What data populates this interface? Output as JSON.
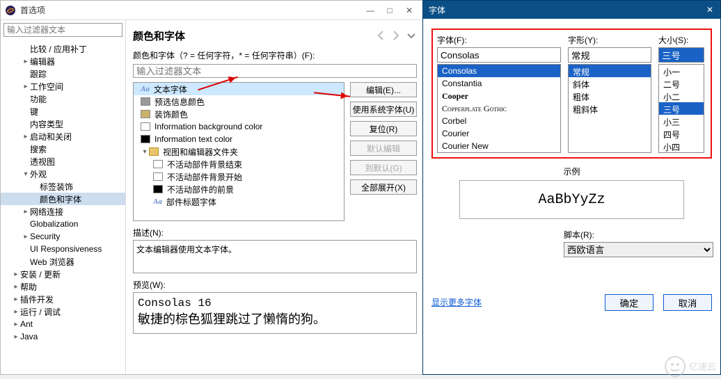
{
  "prefs": {
    "title": "首选项",
    "filter_placeholder": "输入过滤器文本",
    "tree": [
      {
        "label": "比较 / 应用补丁",
        "indent": 2,
        "tw": ""
      },
      {
        "label": "编辑器",
        "indent": 2,
        "tw": "▸"
      },
      {
        "label": "跟踪",
        "indent": 2,
        "tw": ""
      },
      {
        "label": "工作空间",
        "indent": 2,
        "tw": "▸"
      },
      {
        "label": "功能",
        "indent": 2,
        "tw": ""
      },
      {
        "label": "键",
        "indent": 2,
        "tw": ""
      },
      {
        "label": "内容类型",
        "indent": 2,
        "tw": ""
      },
      {
        "label": "启动和关闭",
        "indent": 2,
        "tw": "▸"
      },
      {
        "label": "搜索",
        "indent": 2,
        "tw": ""
      },
      {
        "label": "透视图",
        "indent": 2,
        "tw": ""
      },
      {
        "label": "外观",
        "indent": 2,
        "tw": "▾",
        "open": true
      },
      {
        "label": "标签装饰",
        "indent": 3,
        "tw": ""
      },
      {
        "label": "颜色和字体",
        "indent": 3,
        "tw": "",
        "sel": true
      },
      {
        "label": "网络连接",
        "indent": 2,
        "tw": "▸"
      },
      {
        "label": "Globalization",
        "indent": 2,
        "tw": ""
      },
      {
        "label": "Security",
        "indent": 2,
        "tw": "▸"
      },
      {
        "label": "UI Responsiveness",
        "indent": 2,
        "tw": ""
      },
      {
        "label": "Web 浏览器",
        "indent": 2,
        "tw": ""
      },
      {
        "label": "安装 / 更新",
        "indent": 1,
        "tw": "▸"
      },
      {
        "label": "帮助",
        "indent": 1,
        "tw": "▸"
      },
      {
        "label": "插件开发",
        "indent": 1,
        "tw": "▸"
      },
      {
        "label": "运行 / 调试",
        "indent": 1,
        "tw": "▸"
      },
      {
        "label": "Ant",
        "indent": 1,
        "tw": "▸"
      },
      {
        "label": "Java",
        "indent": 1,
        "tw": "▸"
      }
    ]
  },
  "right": {
    "heading": "颜色和字体",
    "hint": "颜色和字体（? = 任何字符，* = 任何字符串）(F):",
    "filter_placeholder": "输入过滤器文本",
    "items": [
      {
        "type": "aa",
        "label": "文本字体",
        "sel": true
      },
      {
        "type": "sw",
        "color": "#9a9a9a",
        "label": "预选信息颜色"
      },
      {
        "type": "sw",
        "color": "#c9b26a",
        "label": "装饰颜色"
      },
      {
        "type": "sw",
        "color": "#ffffff",
        "label": "Information background color"
      },
      {
        "type": "sw",
        "color": "#000000",
        "label": "Information text color"
      },
      {
        "type": "folder",
        "label": "视图和编辑器文件夹",
        "tw": "▾"
      },
      {
        "type": "sw",
        "color": "#ffffff",
        "label": "不活动部件背景结束",
        "indent": true
      },
      {
        "type": "sw",
        "color": "#ffffff",
        "label": "不活动部件背景开始",
        "indent": true
      },
      {
        "type": "sw",
        "color": "#000000",
        "label": "不活动部件的前景",
        "indent": true
      },
      {
        "type": "aa",
        "label": "部件标题字体",
        "indent": true
      }
    ],
    "buttons": {
      "edit": "编辑(E)...",
      "sysfont": "使用系统字体(U)",
      "reset": "复位(R)",
      "default": "默认编辑",
      "todefault": "到默认(G)",
      "expand": "全部展开(X)"
    },
    "desc_label": "描述(N):",
    "desc": "文本编辑器使用文本字体。",
    "preview_label": "预览(W):",
    "preview_line1": "Consolas 16",
    "preview_line2": "敏捷的棕色狐狸跳过了懒惰的狗。"
  },
  "font": {
    "title": "字体",
    "font_label": "字体(F):",
    "style_label": "字形(Y):",
    "size_label": "大小(S):",
    "font_value": "Consolas",
    "style_value": "常规",
    "size_value": "三号",
    "fonts": [
      "Consolas",
      "Constantia",
      "Cooper",
      "Copperplate Gothic",
      "Corbel",
      "Courier",
      "Courier New"
    ],
    "font_sel": 0,
    "styles": [
      "常规",
      "斜体",
      "粗体",
      "粗斜体"
    ],
    "style_sel": 0,
    "sizes": [
      "小一",
      "二号",
      "小二",
      "三号",
      "小三",
      "四号",
      "小四"
    ],
    "size_sel": 3,
    "sample_label": "示例",
    "sample": "AaBbYyZz",
    "script_label": "脚本(R):",
    "script_value": "西欧语言",
    "more": "显示更多字体",
    "ok": "确定",
    "cancel": "取消"
  },
  "watermark": "亿速云"
}
